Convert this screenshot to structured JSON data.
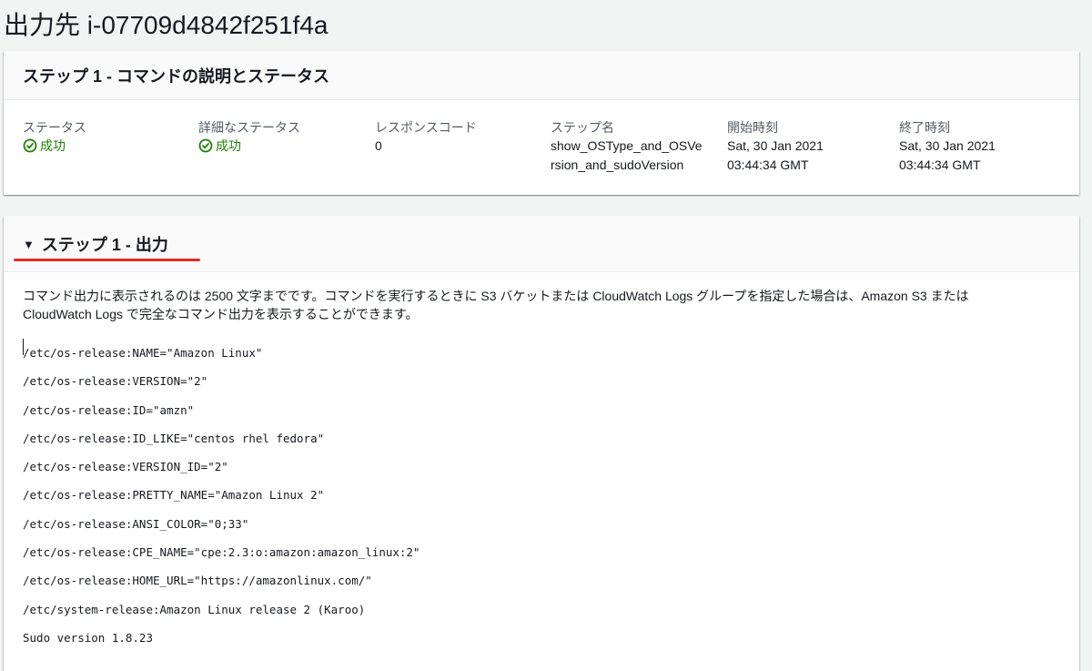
{
  "page": {
    "title": "出力先 i-07709d4842f251f4a"
  },
  "step_panel": {
    "heading": "ステップ 1 - コマンドの説明とステータス",
    "fields": {
      "status": {
        "label": "ステータス",
        "value": "成功"
      },
      "detailed_status": {
        "label": "詳細なステータス",
        "value": "成功"
      },
      "response_code": {
        "label": "レスポンスコード",
        "value": "0"
      },
      "step_name": {
        "label": "ステップ名",
        "value_line1": "show_OSType_and_OSVe",
        "value_line2": "rsion_and_sudoVersion"
      },
      "start_time": {
        "label": "開始時刻",
        "value_line1": "Sat, 30 Jan 2021",
        "value_line2": "03:44:34 GMT"
      },
      "end_time": {
        "label": "終了時刻",
        "value_line1": "Sat, 30 Jan 2021",
        "value_line2": "03:44:34 GMT"
      }
    }
  },
  "output_panel": {
    "toggle_icon": "caret-down-icon",
    "heading": "ステップ 1 - 出力",
    "description_line1": "コマンド出力に表示されるのは 2500 文字までです。コマンドを実行するときに S3 バケットまたは CloudWatch Logs グループを指定した場合は、Amazon S3 または",
    "description_line2": "CloudWatch Logs で完全なコマンド出力を表示することができます。",
    "lines": [
      "/etc/os-release:NAME=\"Amazon Linux\"",
      "/etc/os-release:VERSION=\"2\"",
      "/etc/os-release:ID=\"amzn\"",
      "/etc/os-release:ID_LIKE=\"centos rhel fedora\"",
      "/etc/os-release:VERSION_ID=\"2\"",
      "/etc/os-release:PRETTY_NAME=\"Amazon Linux 2\"",
      "/etc/os-release:ANSI_COLOR=\"0;33\"",
      "/etc/os-release:CPE_NAME=\"cpe:2.3:o:amazon:amazon_linux:2\"",
      "/etc/os-release:HOME_URL=\"https://amazonlinux.com/\"",
      "/etc/system-release:Amazon Linux release 2 (Karoo)",
      "Sudo version 1.8.23"
    ]
  },
  "colors": {
    "success": "#1d8102",
    "highlight_underline": "#e32a23",
    "background": "#f2f3f3"
  }
}
